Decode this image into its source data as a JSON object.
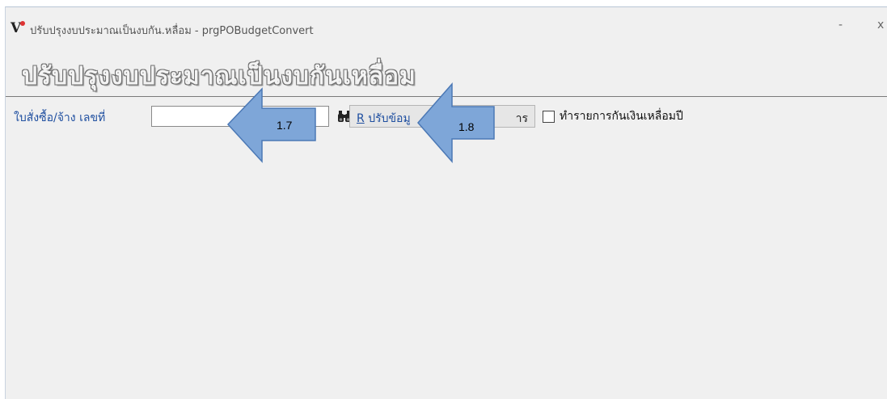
{
  "window": {
    "title": "ปรับปรุงงบประมาณเป็นงบกัน.หลื่อม - prgPOBudgetConvert",
    "minimize_label": "-",
    "close_label": "x"
  },
  "heading": "ปรับปรุงงบประมาณเป็นงบกันเหลื่อม",
  "toolbar": {
    "po_label": "ใบสั่งซื้อ/จ้าง เลขที่",
    "po_value": "",
    "refresh_hotkey": "R",
    "refresh_label": "ปรับข้อมู",
    "refresh_suffix": "าร",
    "checkbox_label": "ทำรายการกันเงินเหลื่อมปี",
    "checkbox_checked": false
  },
  "annotations": [
    {
      "label": "1.7"
    },
    {
      "label": "1.8"
    }
  ],
  "colors": {
    "label_blue": "#1f4fa0",
    "arrow_fill": "#7ea6d8",
    "arrow_stroke": "#4b78b5"
  }
}
